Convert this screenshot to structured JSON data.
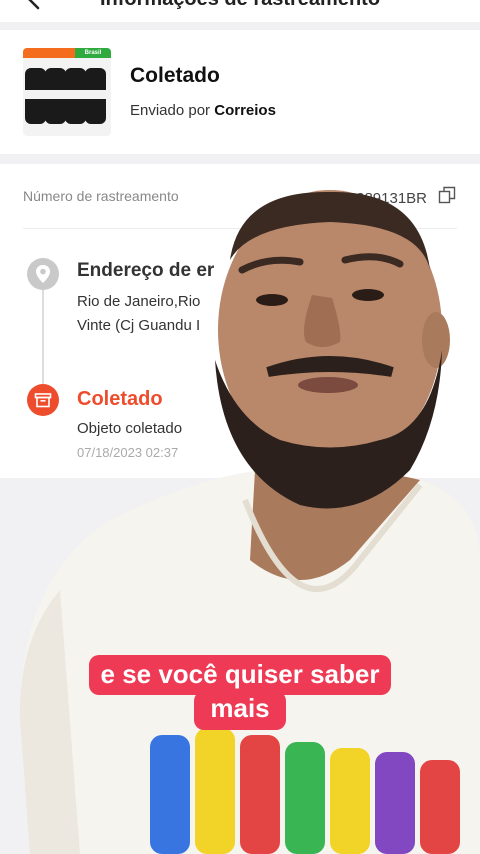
{
  "header": {
    "title": "Informações de rastreamento"
  },
  "package": {
    "status": "Coletado",
    "sender_prefix": "Enviado por",
    "carrier": "Correios",
    "thumb_tag_right": "Brasil"
  },
  "tracking": {
    "number_label": "Número de rastreamento",
    "number_value": "0289131BR"
  },
  "timeline": [
    {
      "title": "Endereço de er",
      "line1": "Rio de Janeiro,Rio",
      "line2": "Vinte (Cj Guandu I"
    },
    {
      "title": "Coletado",
      "description": "Objeto coletado",
      "time": "07/18/2023 02:37"
    }
  ],
  "caption": {
    "line1": "e se você quiser saber",
    "line2": "mais"
  },
  "colors": {
    "accent": "#ee4d2d",
    "caption_bg": "#ee3a54"
  }
}
